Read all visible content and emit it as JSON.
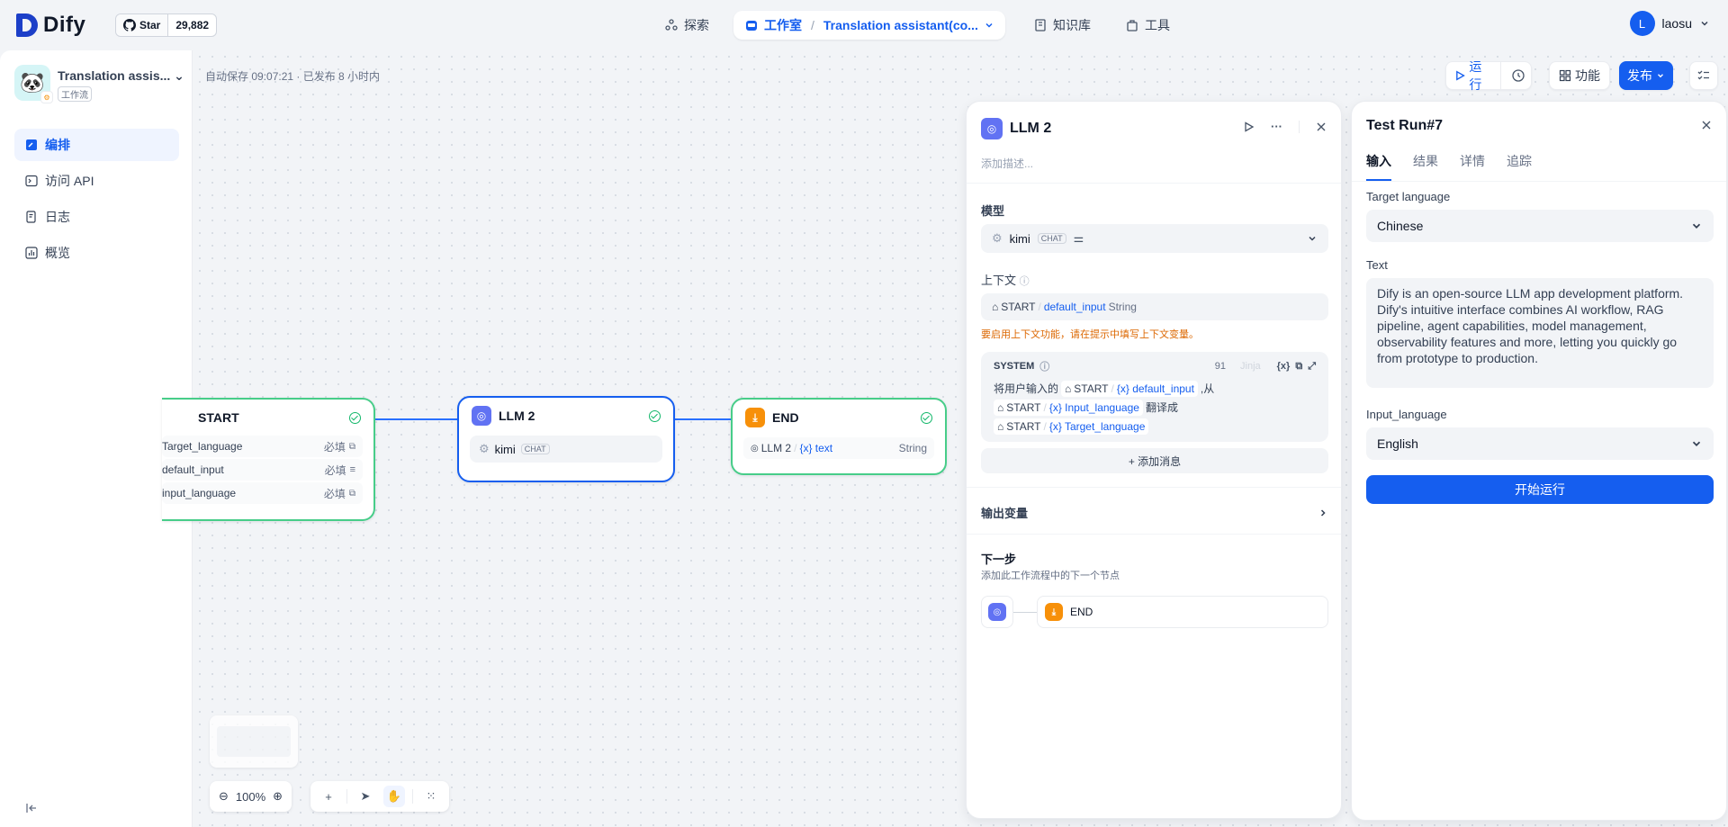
{
  "brand": {
    "logo_text": "Dify"
  },
  "github": {
    "star_label": "Star",
    "count": "29,882"
  },
  "nav": {
    "explore": "探索",
    "studio": "工作室",
    "current_app": "Translation assistant(co...",
    "knowledge": "知识库",
    "tools": "工具"
  },
  "user": {
    "initial": "L",
    "name": "laosu"
  },
  "app": {
    "name": "Translation assis...",
    "type": "工作流"
  },
  "sidebar": {
    "items": [
      {
        "label": "编排",
        "icon": "layout-icon"
      },
      {
        "label": "访问 API",
        "icon": "terminal-icon"
      },
      {
        "label": "日志",
        "icon": "log-icon"
      },
      {
        "label": "概览",
        "icon": "chart-icon"
      }
    ]
  },
  "canvas": {
    "autosave": "自动保存 09:07:21 · 已发布 8 小时内",
    "zoom": "100%"
  },
  "toolbar": {
    "run": "运行",
    "features": "功能",
    "publish": "发布"
  },
  "nodes": {
    "start": {
      "title": "START",
      "vars": [
        {
          "name": "Target_language",
          "req": "必填"
        },
        {
          "name": "default_input",
          "req": "必填"
        },
        {
          "name": "input_language",
          "req": "必填"
        }
      ]
    },
    "llm": {
      "title": "LLM 2",
      "model": "kimi",
      "mode": "CHAT"
    },
    "end": {
      "title": "END",
      "source": "LLM 2",
      "var": "{x} text",
      "type": "String"
    }
  },
  "llm_panel": {
    "title": "LLM 2",
    "desc_placeholder": "添加描述...",
    "model_label": "模型",
    "model": "kimi",
    "model_mode": "CHAT",
    "context_label": "上下文",
    "context_node": "START",
    "context_var": "default_input",
    "context_type": "String",
    "context_warning": "要启用上下文功能，请在提示中填写上下文变量。",
    "system_label": "SYSTEM",
    "system_count": "91",
    "jinja": "Jinja",
    "prompt_prefix": "将用户输入的",
    "prompt_node": "START",
    "prompt_var1": "{x} default_input",
    "prompt_from": ",从",
    "prompt_var2": "{x} Input_language",
    "prompt_translate": "翻译成",
    "prompt_var3": "{x} Target_language",
    "add_message": "+ 添加消息",
    "output_vars": "输出变量",
    "next_step": "下一步",
    "next_desc": "添加此工作流程中的下一个节点",
    "next_node": "END"
  },
  "test_panel": {
    "title": "Test Run#7",
    "tabs": [
      "输入",
      "结果",
      "详情",
      "追踪"
    ],
    "target_label": "Target language",
    "target_value": "Chinese",
    "text_label": "Text",
    "text_value": "Dify is an open-source LLM app development platform. Dify's intuitive interface combines AI workflow, RAG pipeline, agent capabilities, model management, observability features and more, letting you quickly go from prototype to production.",
    "input_lang_label": "Input_language",
    "input_lang_value": "English",
    "start_button": "开始运行"
  }
}
